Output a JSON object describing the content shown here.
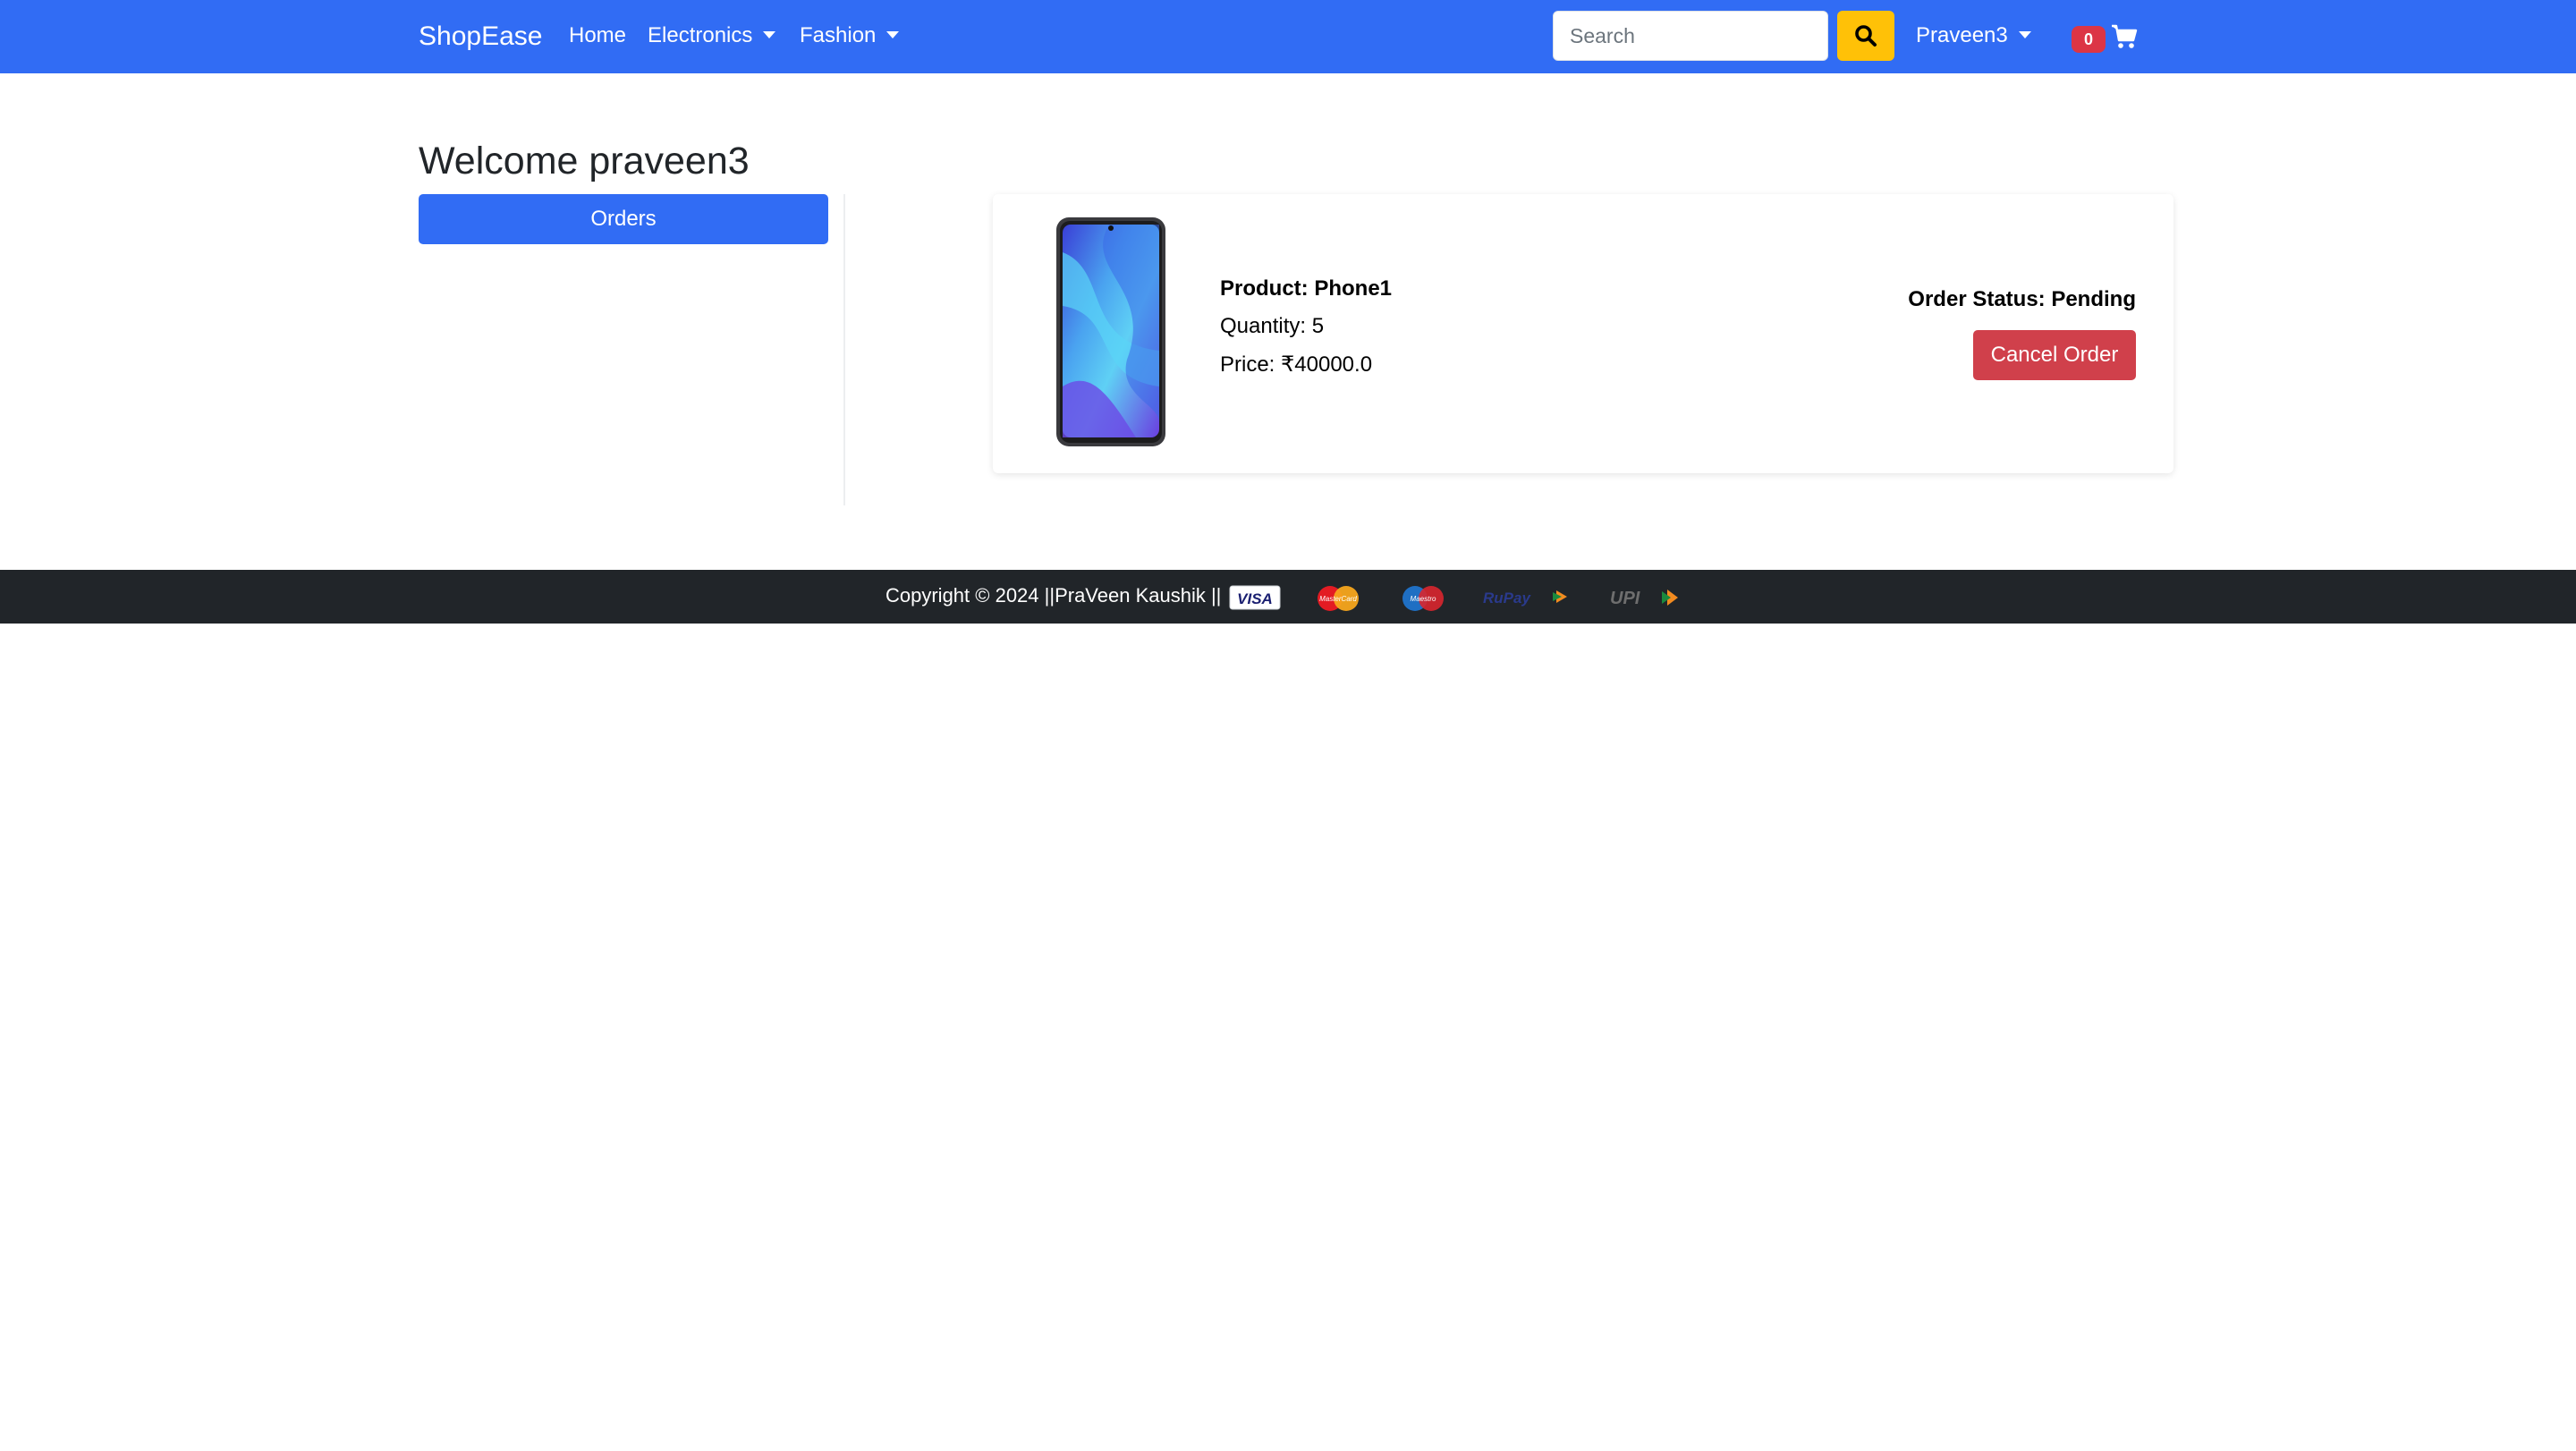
{
  "navbar": {
    "brand": "ShopEase",
    "links": [
      {
        "label": "Home"
      },
      {
        "label": "Electronics"
      },
      {
        "label": "Fashion"
      }
    ],
    "search": {
      "placeholder": "Search",
      "value": ""
    },
    "search_icon": "search-icon",
    "user_menu": {
      "label": "Praveen3"
    },
    "cart": {
      "count": "0",
      "icon": "cart-icon"
    }
  },
  "main": {
    "welcome": "Welcome praveen3",
    "sidebar": {
      "orders_button": "Orders"
    },
    "orders": [
      {
        "product": "Product: Phone1",
        "quantity": "Quantity: 5",
        "price": "Price: ₹40000.0",
        "status": "Order Status: Pending",
        "cancel_label": "Cancel Order"
      }
    ]
  },
  "footer": {
    "copyright": "Copyright © 2024 ||PraVeen Kaushik ||",
    "payment_logos": [
      "VISA",
      "MasterCard",
      "Maestro",
      "RuPay",
      "UPI"
    ]
  },
  "colors": {
    "navbar": "#316cf4",
    "search_button": "#ffc107",
    "cancel_button": "#d0404b",
    "badge": "#dc3545",
    "footer": "#212529"
  }
}
